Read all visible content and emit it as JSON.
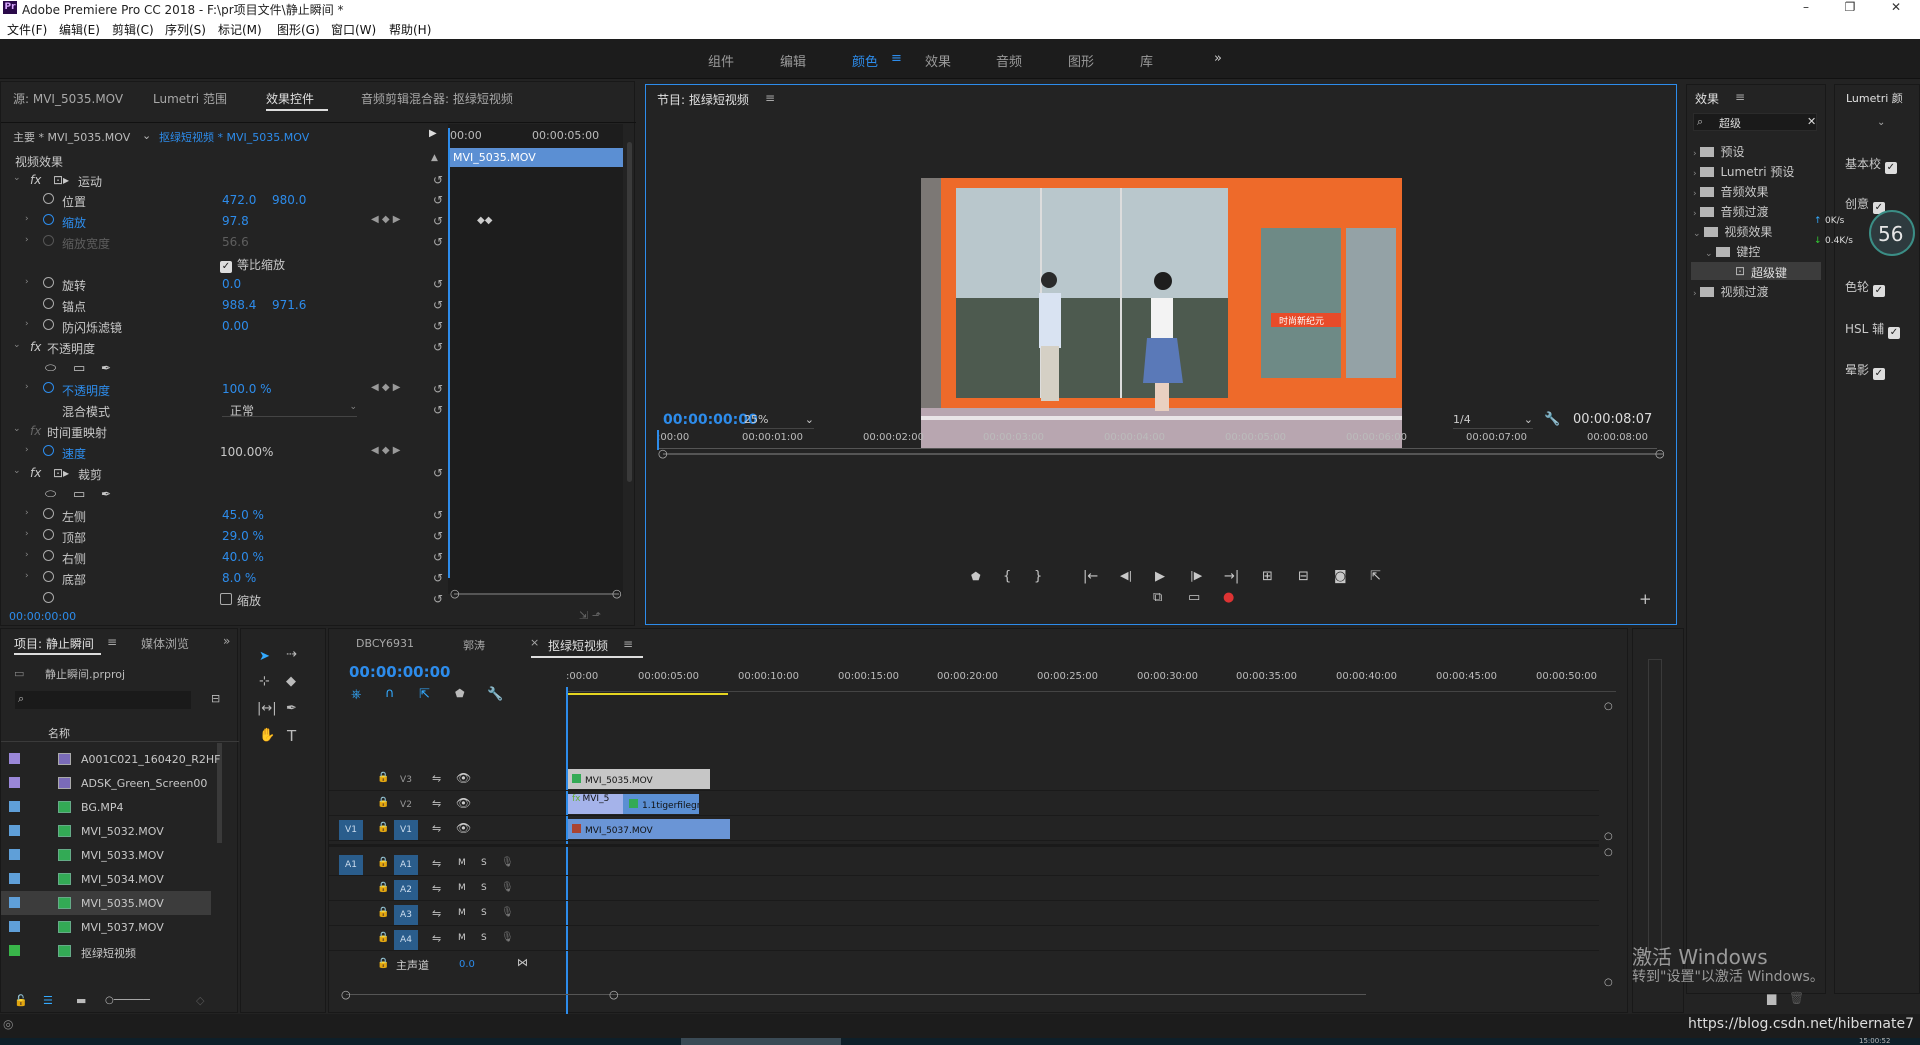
{
  "window": {
    "title": "Adobe Premiere Pro CC 2018 - F:\\pr项目文件\\静止瞬间 *",
    "logo": "Pr",
    "min": "–",
    "max": "❐",
    "close": "✕"
  },
  "menu": [
    "文件(F)",
    "编辑(E)",
    "剪辑(C)",
    "序列(S)",
    "标记(M)",
    "图形(G)",
    "窗口(W)",
    "帮助(H)"
  ],
  "workspaces": {
    "items": [
      "组件",
      "编辑",
      "颜色",
      "效果",
      "音频",
      "图形",
      "库"
    ],
    "active": "颜色",
    "more": "»"
  },
  "effect_controls": {
    "tabs": [
      "源: MVI_5035.MOV",
      "Lumetri 范围",
      "效果控件",
      "音频剪辑混合器: 抠绿短视频"
    ],
    "master_label": "主要 * MVI_5035.MOV",
    "sequence_label": "抠绿短视频 * MVI_5035.MOV",
    "timeline_start": "00:00",
    "timeline_end": "00:00:05:00",
    "clip_name": "MVI_5035.MOV",
    "section_video": "视频效果",
    "motion": "运动",
    "position": "位置",
    "position_x": "472.0",
    "position_y": "980.0",
    "scale": "缩放",
    "scale_v": "97.8",
    "scale_width": "缩放宽度",
    "scale_width_v": "56.6",
    "uniform_scale": "等比缩放",
    "rotation": "旋转",
    "rotation_v": "0.0",
    "anchor": "锚点",
    "anchor_x": "988.4",
    "anchor_y": "971.6",
    "antiflicker": "防闪烁滤镜",
    "antiflicker_v": "0.00",
    "opacity_fx": "不透明度",
    "opacity": "不透明度",
    "opacity_v": "100.0 %",
    "blend": "混合模式",
    "blend_v": "正常",
    "time_remap": "时间重映射",
    "speed": "速度",
    "speed_v": "100.00%",
    "crop": "裁剪",
    "left": "左侧",
    "left_v": "45.0 %",
    "top": "顶部",
    "top_v": "29.0 %",
    "right": "右侧",
    "right_v": "40.0 %",
    "bottom": "底部",
    "bottom_v": "8.0 %",
    "zoom": "缩放",
    "timecode": "00:00:00:00"
  },
  "program": {
    "title": "节目: 抠绿短视频",
    "timecode": "00:00:00:00",
    "zoom": "25%",
    "quality": "1/4",
    "duration": "00:00:08:07",
    "ruler": [
      ":00:00",
      "00:00:01:00",
      "00:00:02:00",
      "00:00:03:00",
      "00:00:04:00",
      "00:00:05:00",
      "00:00:06:00",
      "00:00:07:00",
      "00:00:08:00"
    ],
    "sign_text": "时尚新纪元"
  },
  "effects": {
    "title": "效果",
    "search": "超级",
    "items": [
      "预设",
      "Lumetri 预设",
      "音频效果",
      "音频过渡",
      "视频效果",
      "键控",
      "超级键",
      "视频过渡"
    ],
    "speed_up": "0K/s",
    "speed_down": "0.4K/s",
    "percent": "56"
  },
  "lumetri": {
    "title": "Lumetri 颜",
    "items": [
      "基本校",
      "创意",
      "色轮",
      "HSL 辅",
      "晕影"
    ]
  },
  "project": {
    "tabs": [
      "项目: 静止瞬间",
      "媒体浏览"
    ],
    "more": "»",
    "file": "静止瞬间.prproj",
    "col_name": "名称",
    "items": [
      {
        "name": "A001C021_160420_R2HF",
        "color": "#9a87d8"
      },
      {
        "name": "ADSK_Green_Screen00",
        "color": "#9a87d8"
      },
      {
        "name": "BG.MP4",
        "color": "#5f9fd8"
      },
      {
        "name": "MVI_5032.MOV",
        "color": "#5f9fd8"
      },
      {
        "name": "MVI_5033.MOV",
        "color": "#5f9fd8"
      },
      {
        "name": "MVI_5034.MOV",
        "color": "#5f9fd8"
      },
      {
        "name": "MVI_5035.MOV",
        "color": "#5f9fd8"
      },
      {
        "name": "MVI_5037.MOV",
        "color": "#5f9fd8"
      },
      {
        "name": "抠绿短视频",
        "color": "#39b54a"
      }
    ]
  },
  "timeline": {
    "tabs": [
      "DBCY6931",
      "郭涛",
      "抠绿短视频"
    ],
    "timecode": "00:00:00:00",
    "ruler": [
      ":00:00",
      "00:00:05:00",
      "00:00:10:00",
      "00:00:15:00",
      "00:00:20:00",
      "00:00:25:00",
      "00:00:30:00",
      "00:00:35:00",
      "00:00:40:00",
      "00:00:45:00",
      "00:00:50:00"
    ],
    "tracks_video": [
      "V3",
      "V2",
      "V1"
    ],
    "tracks_audio": [
      "A1",
      "A2",
      "A3",
      "A4"
    ],
    "src_v": "V1",
    "src_a": "A1",
    "clip_v3": "MVI_5035.MOV",
    "clip_v2a": "MVI_5",
    "clip_v2b": "1.1tigerfilegre",
    "clip_v1": "MVI_5037.MOV",
    "master": "主声道",
    "master_v": "0.0",
    "m": "M",
    "s": "S"
  },
  "watermark": {
    "line1": "激活 Windows",
    "line2": "转到\"设置\"以激活 Windows。"
  },
  "url": "https://blog.csdn.net/hibernate7",
  "clock": "15:00:52"
}
